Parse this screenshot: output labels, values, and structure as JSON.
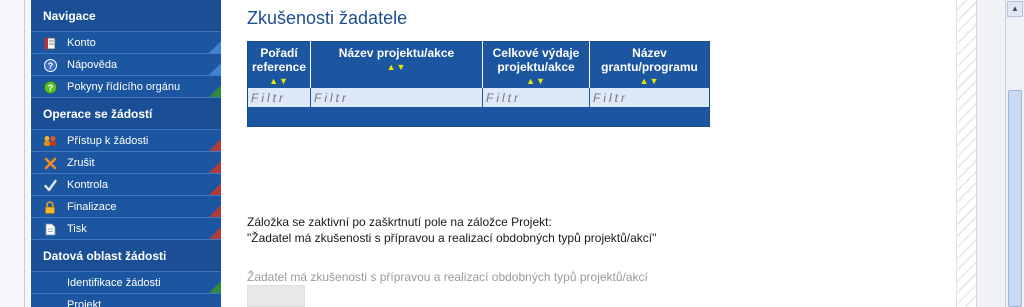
{
  "sidebar": {
    "sections": [
      {
        "title": "Navigace",
        "items": [
          {
            "label": "Konto",
            "icon": "book-icon"
          },
          {
            "label": "Nápověda",
            "icon": "help-icon"
          },
          {
            "label": "Pokyny řídícího orgánu",
            "icon": "info-icon"
          }
        ]
      },
      {
        "title": "Operace se žádostí",
        "items": [
          {
            "label": "Přístup k žádosti",
            "icon": "users-icon"
          },
          {
            "label": "Zrušit",
            "icon": "cancel-icon"
          },
          {
            "label": "Kontrola",
            "icon": "check-icon"
          },
          {
            "label": "Finalizace",
            "icon": "lock-icon"
          },
          {
            "label": "Tisk",
            "icon": "print-icon"
          }
        ]
      },
      {
        "title": "Datová oblast žádosti",
        "items": [
          {
            "label": "Identifikace žádosti",
            "icon": ""
          },
          {
            "label": "Projekt",
            "icon": ""
          }
        ]
      }
    ]
  },
  "main": {
    "title": "Zkušenosti žadatele",
    "table": {
      "columns": [
        "Pořadí reference",
        "Název projektu/akce",
        "Celkové výdaje projektu/akce",
        "Název grantu/programu"
      ],
      "sort_glyph": "▲▼",
      "filter_placeholder": "Filtr"
    },
    "note_line1": "Záložka se zaktivní po zaškrtnutí pole na záložce Projekt:",
    "note_line2": "\"Žadatel má zkušenosti s přípravou a realizací obdobných typů projektů/akcí\"",
    "checkbox_label": "Žadatel má zkušenosti s přípravou a realizací obdobných typů projektů/akcí"
  },
  "colors": {
    "sidebar_bg": "#1c56a0",
    "header_bg": "#1c56a0",
    "title_color": "#1c4f8f",
    "filter_bg": "#dde8f8",
    "sort_arrows": "#e6e600"
  }
}
